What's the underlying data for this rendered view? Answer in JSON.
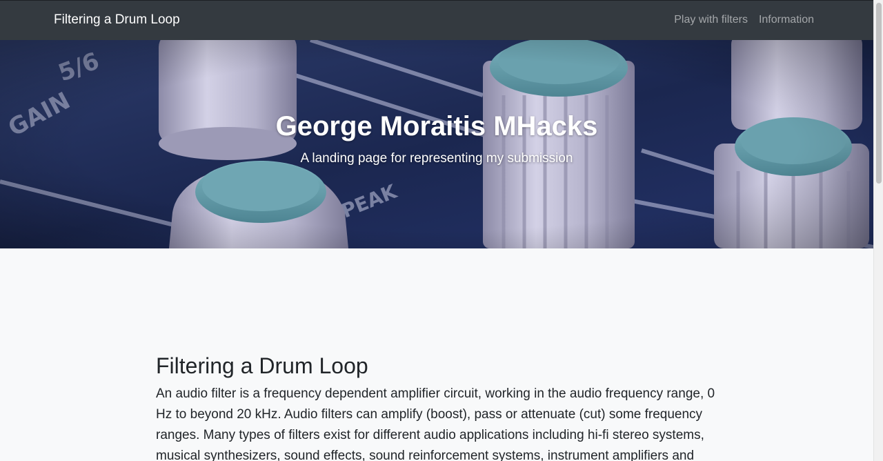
{
  "navbar": {
    "brand": "Filtering a Drum Loop",
    "links": [
      {
        "label": "Play with filters"
      },
      {
        "label": "Information"
      }
    ]
  },
  "hero": {
    "title": "George Moraitis MHacks",
    "subtitle": "A landing page for representing my submission",
    "image_labels": [
      "GAIN",
      "PEAK",
      "5/6"
    ]
  },
  "section": {
    "title": "Filtering a Drum Loop",
    "text": "An audio filter is a frequency dependent amplifier circuit, working in the audio frequency range, 0 Hz to beyond 20 kHz. Audio filters can amplify (boost), pass or attenuate (cut) some frequency ranges. Many types of filters exist for different audio applications including hi-fi stereo systems, musical synthesizers, sound effects, sound reinforcement systems, instrument amplifiers and"
  },
  "colors": {
    "navbar_bg": "#343a40",
    "page_bg": "#f8f9fa",
    "knob_cap": "#5f9aa8",
    "knob_body": "#b8b6cf"
  }
}
